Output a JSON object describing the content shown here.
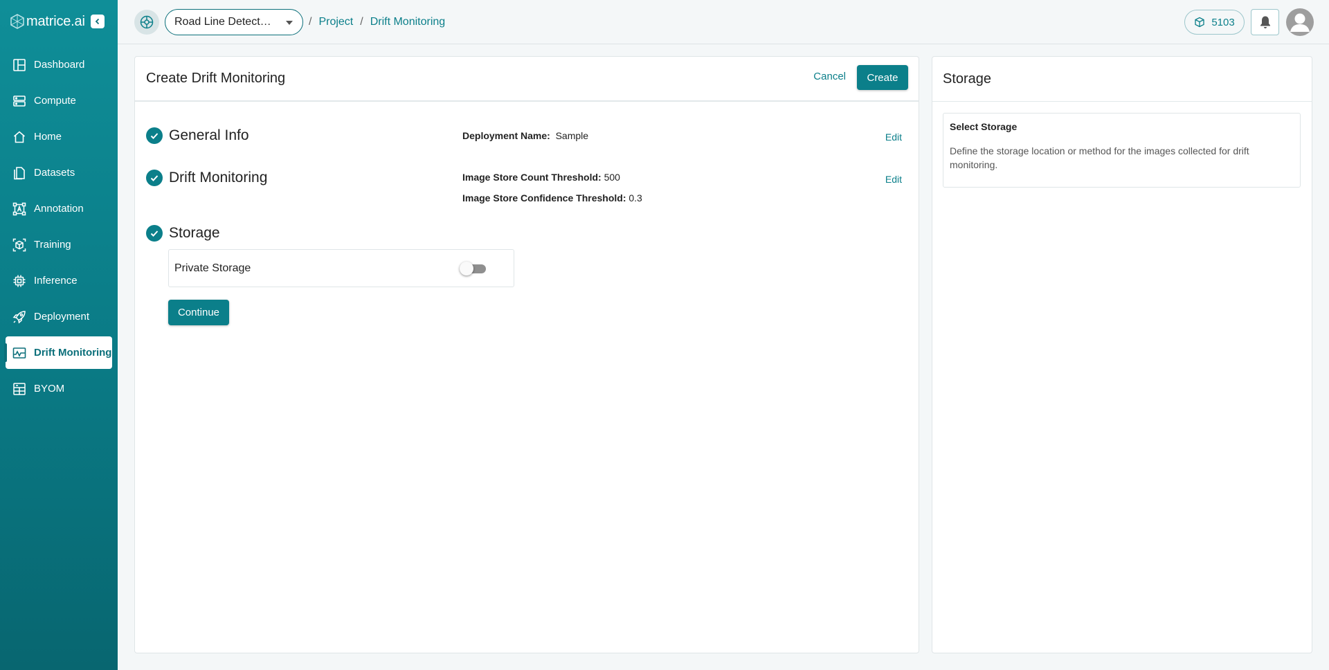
{
  "app": {
    "logo_text": "matrice.ai"
  },
  "sidebar": {
    "items": [
      {
        "label": "Dashboard",
        "icon": "dashboard-icon",
        "active": false
      },
      {
        "label": "Compute",
        "icon": "server-icon",
        "active": false
      },
      {
        "label": "Home",
        "icon": "home-icon",
        "active": false
      },
      {
        "label": "Datasets",
        "icon": "datasets-icon",
        "active": false
      },
      {
        "label": "Annotation",
        "icon": "annotation-icon",
        "active": false
      },
      {
        "label": "Training",
        "icon": "training-icon",
        "active": false
      },
      {
        "label": "Inference",
        "icon": "chip-icon",
        "active": false
      },
      {
        "label": "Deployment",
        "icon": "rocket-icon",
        "active": false
      },
      {
        "label": "Drift Monitoring",
        "icon": "monitor-icon",
        "active": true
      },
      {
        "label": "BYOM",
        "icon": "byom-icon",
        "active": false
      }
    ]
  },
  "header": {
    "project_selected": "Road Line Detect…",
    "breadcrumb": [
      "Project",
      "Drift Monitoring"
    ],
    "breadcrumb_separator": "/",
    "credits": "5103"
  },
  "form": {
    "title": "Create Drift Monitoring",
    "cancel_label": "Cancel",
    "create_label": "Create",
    "edit_label": "Edit",
    "continue_label": "Continue",
    "steps": {
      "general": {
        "title": "General Info",
        "deployment_name_label": "Deployment Name:",
        "deployment_name_value": "Sample"
      },
      "drift": {
        "title": "Drift Monitoring",
        "count_label": "Image Store Count Threshold:",
        "count_value": "500",
        "confidence_label": "Image Store Confidence Threshold:",
        "confidence_value": "0.3"
      },
      "storage": {
        "title": "Storage",
        "private_label": "Private Storage",
        "private_enabled": false
      }
    }
  },
  "panel": {
    "title": "Storage",
    "info_title": "Select Storage",
    "info_text": "Define the storage location or method for the images collected for drift monitoring."
  },
  "colors": {
    "accent": "#0b7f8a",
    "sidebar_top": "#0f8e98",
    "sidebar_bottom": "#086670",
    "background": "#f4f7f8"
  }
}
